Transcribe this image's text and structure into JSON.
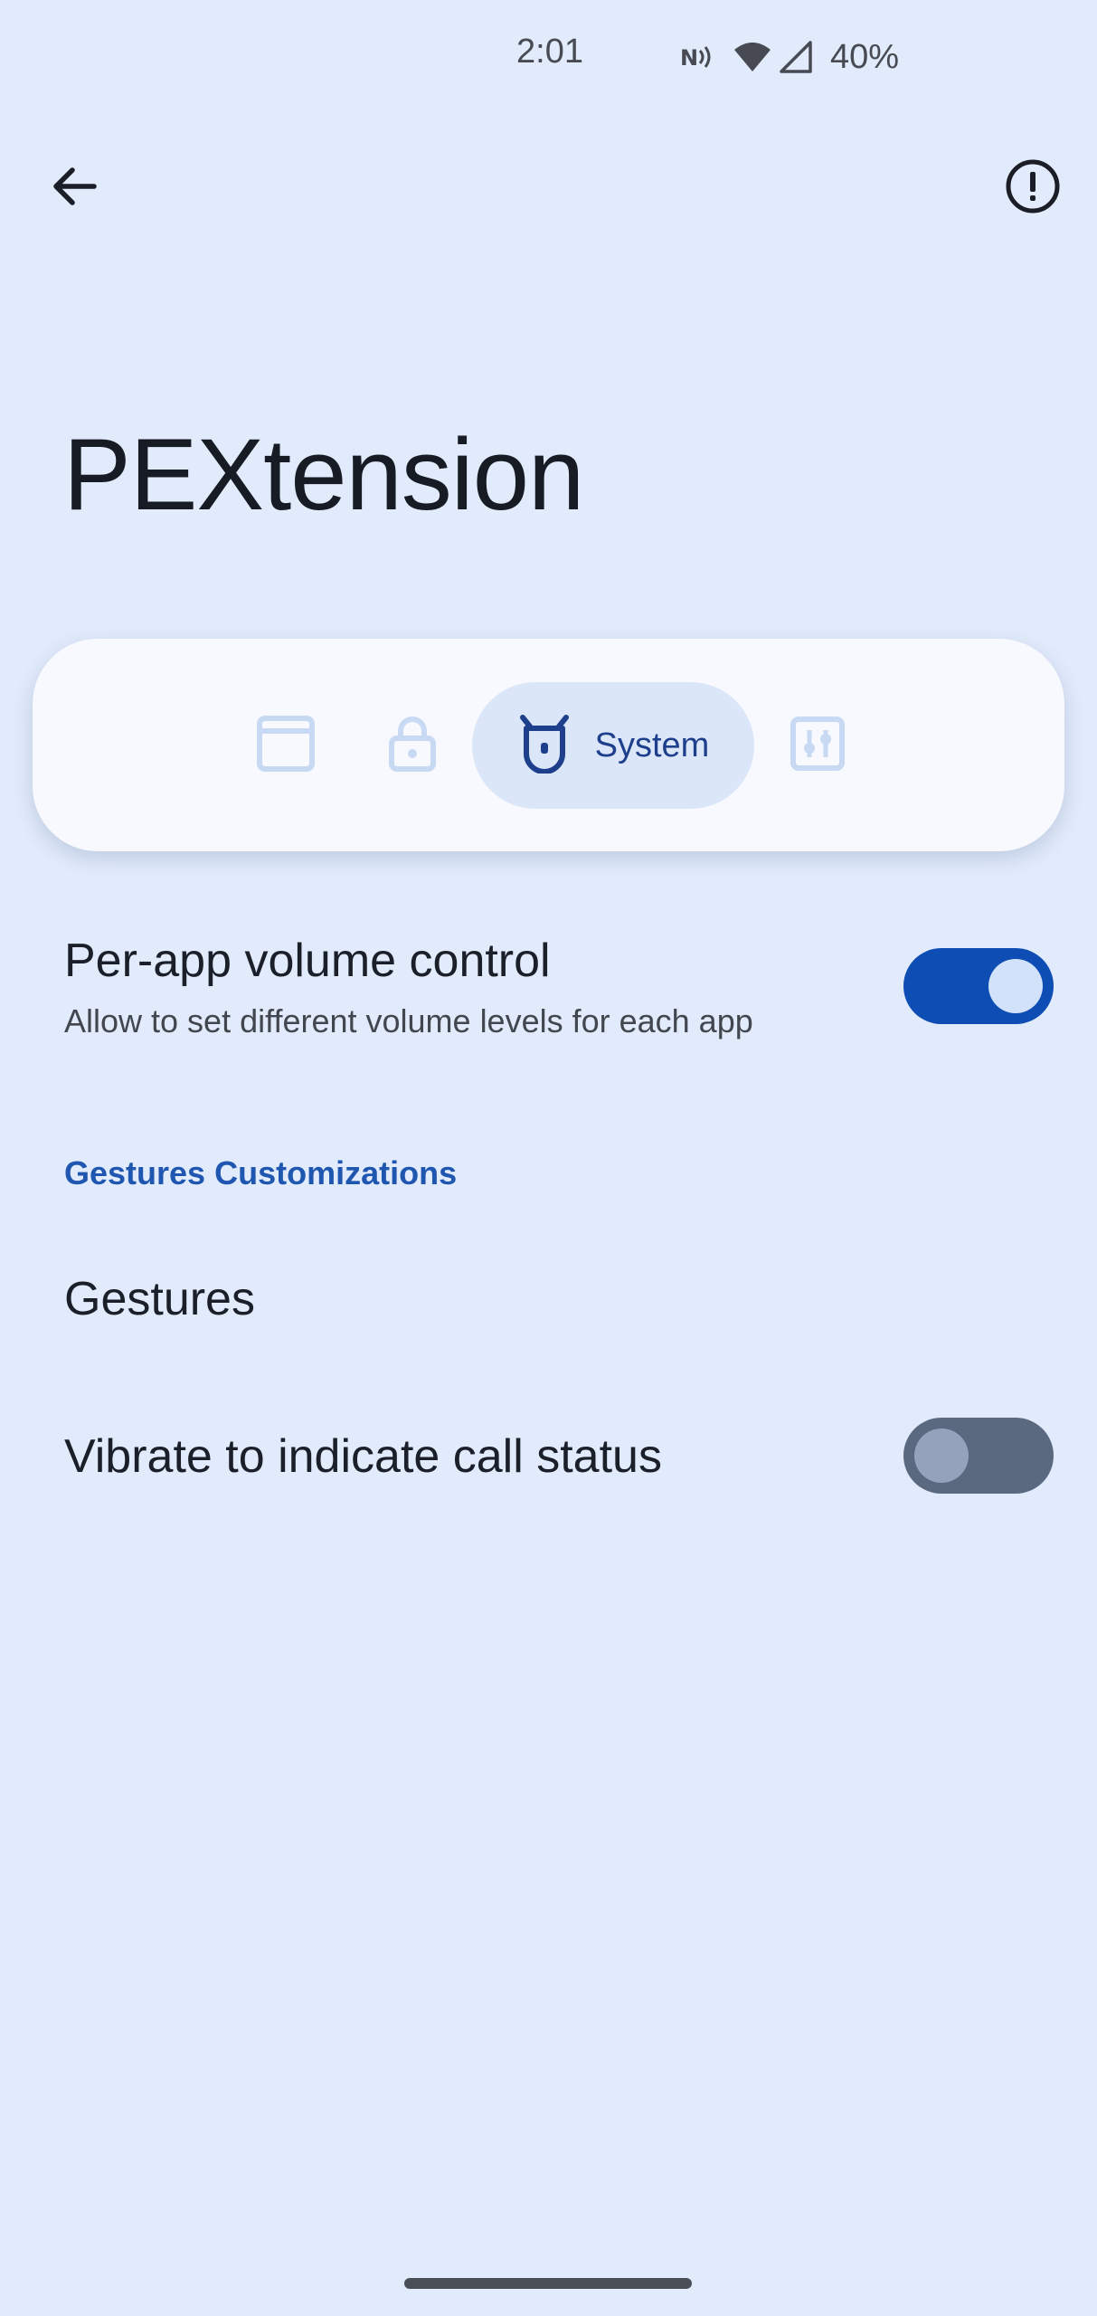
{
  "status_bar": {
    "time": "2:01",
    "battery": "40%",
    "icons": [
      "nfc-icon",
      "wifi-icon",
      "cell-signal-icon"
    ]
  },
  "app_bar": {
    "back_icon": "arrow-back-icon",
    "info_icon": "alert-circle-icon"
  },
  "page": {
    "title": "PEXtension"
  },
  "tabs": [
    {
      "icon": "window-icon",
      "label": "",
      "selected": false
    },
    {
      "icon": "lock-icon",
      "label": "",
      "selected": false
    },
    {
      "icon": "system-icon",
      "label": "System",
      "selected": true
    },
    {
      "icon": "tweaks-icon",
      "label": "",
      "selected": false
    }
  ],
  "settings": {
    "volume": {
      "title": "Per-app volume control",
      "subtitle": "Allow to set different volume levels for each app",
      "enabled": true
    },
    "section_header": "Gestures Customizations",
    "gestures": {
      "title": "Gestures"
    },
    "vibrate": {
      "title": "Vibrate to indicate call status",
      "enabled": false
    }
  },
  "colors": {
    "background": "#e1ebfb",
    "accent": "#0d4db4",
    "section_header": "#1e56b0",
    "switch_off_track": "#5a6880"
  }
}
